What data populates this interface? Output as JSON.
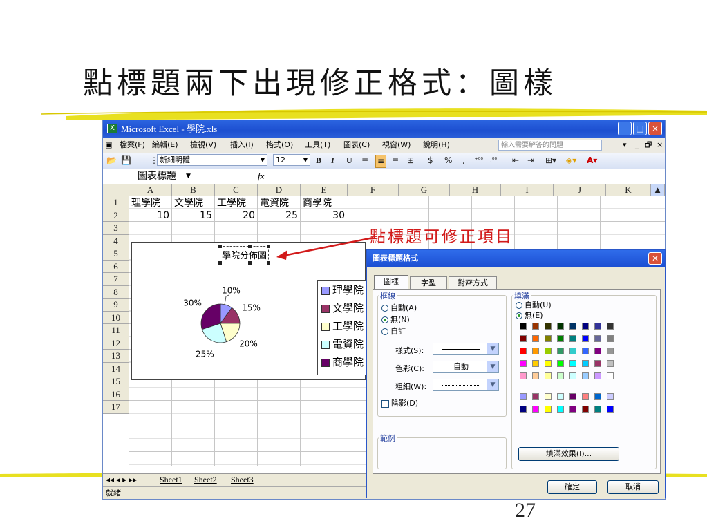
{
  "slide": {
    "title": "點標題兩下出現修正格式：圖樣",
    "page_number": "27"
  },
  "window": {
    "title": "Microsoft Excel - 學院.xls",
    "controls": [
      "_",
      "□",
      "×"
    ]
  },
  "menubar": {
    "items": [
      "檔案(F)",
      "編輯(E)",
      "檢視(V)",
      "插入(I)",
      "格式(O)",
      "工具(T)",
      "圖表(C)",
      "視窗(W)",
      "說明(H)"
    ],
    "help_placeholder": "輸入需要解答的問題",
    "right_controls": [
      "▾",
      "_",
      "🗗",
      "×"
    ]
  },
  "toolbar": {
    "font_name": "新細明體",
    "font_size": "12",
    "bold": "B",
    "italic": "I",
    "underline": "U",
    "currency": "$",
    "percent": "%",
    "comma": ",",
    "inc_decimal": "⁺⁰⁰",
    "dec_decimal": ".⁰⁰"
  },
  "formula_bar": {
    "name_box": "圖表標題",
    "fx": "fx"
  },
  "sheet": {
    "columns": [
      "A",
      "B",
      "C",
      "D",
      "E",
      "F",
      "G",
      "H",
      "I",
      "J",
      "K"
    ],
    "rows": [
      "1",
      "2",
      "3",
      "4",
      "5",
      "6",
      "7",
      "8",
      "9",
      "10",
      "11",
      "12",
      "13",
      "14",
      "15",
      "16",
      "17"
    ],
    "row1": [
      "理學院",
      "文學院",
      "工學院",
      "電資院",
      "商學院"
    ],
    "row2": [
      "10",
      "15",
      "20",
      "25",
      "30"
    ],
    "tabs": [
      "Sheet1",
      "Sheet2",
      "Sheet3"
    ],
    "status": "就緒"
  },
  "chart_data": {
    "type": "pie",
    "title": "學院分佈圖",
    "categories": [
      "理學院",
      "文學院",
      "工學院",
      "電資院",
      "商學院"
    ],
    "values": [
      10,
      15,
      20,
      25,
      30
    ],
    "data_labels": [
      "10%",
      "15%",
      "20%",
      "25%",
      "30%"
    ],
    "colors": [
      "#9999ff",
      "#993366",
      "#ffffcc",
      "#ccffff",
      "#660066"
    ],
    "legend_position": "right"
  },
  "annotation": {
    "text": "點標題可修正項目",
    "color": "#d21a1a"
  },
  "dialog": {
    "title": "圖表標題格式",
    "tabs": [
      "圖樣",
      "字型",
      "對齊方式"
    ],
    "border": {
      "label": "框線",
      "options": [
        "自動(A)",
        "無(N)",
        "自訂"
      ],
      "selected": "無(N)",
      "style_label": "樣式(S):",
      "color_label": "色彩(C):",
      "color_value": "自動",
      "weight_label": "粗細(W):",
      "shadow_label": "陰影(D)"
    },
    "sample_label": "範例",
    "fill": {
      "label": "填滿",
      "options": [
        "自動(U)",
        "無(E)"
      ],
      "selected": "無(E)",
      "effects_button": "填滿效果(I)...",
      "palette_main": [
        "#000000",
        "#993300",
        "#333300",
        "#003300",
        "#003366",
        "#000080",
        "#333399",
        "#333333",
        "#800000",
        "#ff6600",
        "#808000",
        "#008000",
        "#008080",
        "#0000ff",
        "#666699",
        "#808080",
        "#ff0000",
        "#ff9900",
        "#99cc00",
        "#339966",
        "#33cccc",
        "#3366ff",
        "#800080",
        "#969696",
        "#ff00ff",
        "#ffcc00",
        "#ffff00",
        "#00ff00",
        "#00ffff",
        "#00ccff",
        "#993366",
        "#c0c0c0",
        "#ff99cc",
        "#ffcc99",
        "#ffff99",
        "#ccffcc",
        "#ccffff",
        "#99ccff",
        "#cc99ff",
        "#ffffff"
      ],
      "palette_chart": [
        "#9999ff",
        "#993366",
        "#ffffcc",
        "#ccffff",
        "#660066",
        "#ff8080",
        "#0066cc",
        "#ccccff",
        "#000080",
        "#ff00ff",
        "#ffff00",
        "#00ffff",
        "#800080",
        "#800000",
        "#008080",
        "#0000ff"
      ]
    },
    "ok": "確定",
    "cancel": "取消"
  }
}
